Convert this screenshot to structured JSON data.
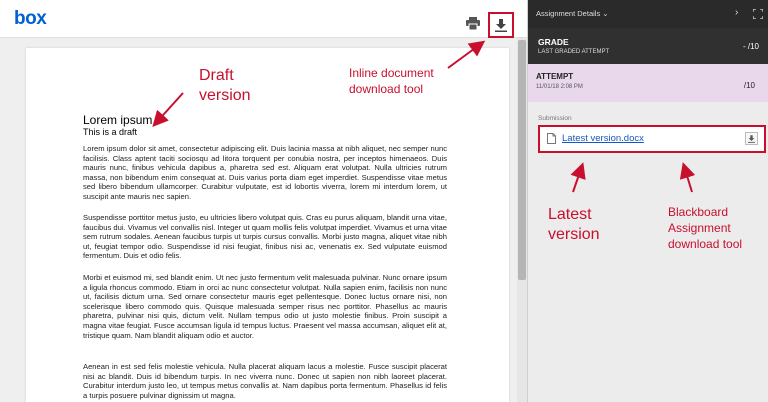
{
  "viewer": {
    "logo": "box",
    "icons": [
      "print-icon",
      "download-icon"
    ],
    "document": {
      "title": "Lorem ipsum",
      "subtitle": "This is a draft",
      "paragraphs": [
        "Lorem ipsum dolor sit amet, consectetur adipiscing elit. Duis lacinia massa at nibh aliquet, nec semper nunc facilisis. Class aptent taciti sociosqu ad litora torquent per conubia nostra, per inceptos himenaeos. Duis mauris nunc, finibus vehicula dapibus a, pharetra sed est. Aliquam erat volutpat. Nulla ultricies rutrum massa, non bibendum enim consequat at. Duis varius porta diam eget imperdiet. Suspendisse vitae metus sed libero bibendum ullamcorper. Curabitur vulputate, est id lobortis viverra, lorem mi interdum lorem, ut suscipit ante mauris nec sapien.",
        "Suspendisse porttitor metus justo, eu ultricies libero volutpat quis. Cras eu purus aliquam, blandit urna vitae, faucibus dui. Vivamus vel convallis nisl. Integer ut quam mollis felis volutpat imperdiet. Vivamus et urna vitae sem rutrum sodales. Aenean faucibus turpis ut turpis cursus convallis. Morbi justo magna, aliquet vitae nibh ut, feugiat tempor odio. Suspendisse id nisi feugiat, finibus nisi ac, venenatis ex. Sed vulputate euismod fermentum. Duis et odio felis.",
        "Morbi et euismod mi, sed blandit enim. Ut nec justo fermentum velit malesuada pulvinar. Nunc ornare ipsum a ligula rhoncus commodo. Etiam in orci ac nunc consectetur volutpat. Nulla sapien enim, facilisis non nunc ut, facilisis dictum urna. Sed ornare consectetur mauris eget pellentesque. Donec luctus ornare nisi, non scelerisque libero commodo quis. Quisque malesuada semper risus nec porttitor. Phasellus ac mauris pharetra, pulvinar nisi quis, dictum velit. Nullam tempus odio ut justo molestie finibus. Proin suscipit a magna vitae feugiat. Fusce accumsan ligula id tempus luctus. Praesent vel massa accumsan, aliquet elit at, tristique quam. Nam blandit aliquam odio et auctor.",
        "Aenean in est sed felis molestie vehicula. Nulla placerat aliquam lacus a molestie. Fusce suscipit placerat nisi ac blandit. Duis id bibendum turpis. In nec viverra nunc. Donec ut sapien non nibh laoreet placerat. Curabitur interdum justo leo, ut tempus metus convallis at. Nam dapibus porta fermentum. Phasellus id felis a turpis posuere pulvinar dignissim ut magna."
      ]
    }
  },
  "annotations": {
    "draft": "Draft\nversion",
    "inline": "Inline document\ndownload tool",
    "latest": "Latest\nversion",
    "blackboard": "Blackboard\nAssignment\ndownload tool",
    "color": "#c8102e"
  },
  "panel": {
    "header_title": "Assignment Details ⌄",
    "grade": {
      "label": "GRADE",
      "sublabel": "LAST GRADED ATTEMPT",
      "value": "- /10"
    },
    "attempt": {
      "label": "ATTEMPT",
      "date": "11/01/18 2:08 PM",
      "value": "/10"
    },
    "submission": {
      "label": "Submission",
      "file_name": "Latest version.docx"
    }
  }
}
